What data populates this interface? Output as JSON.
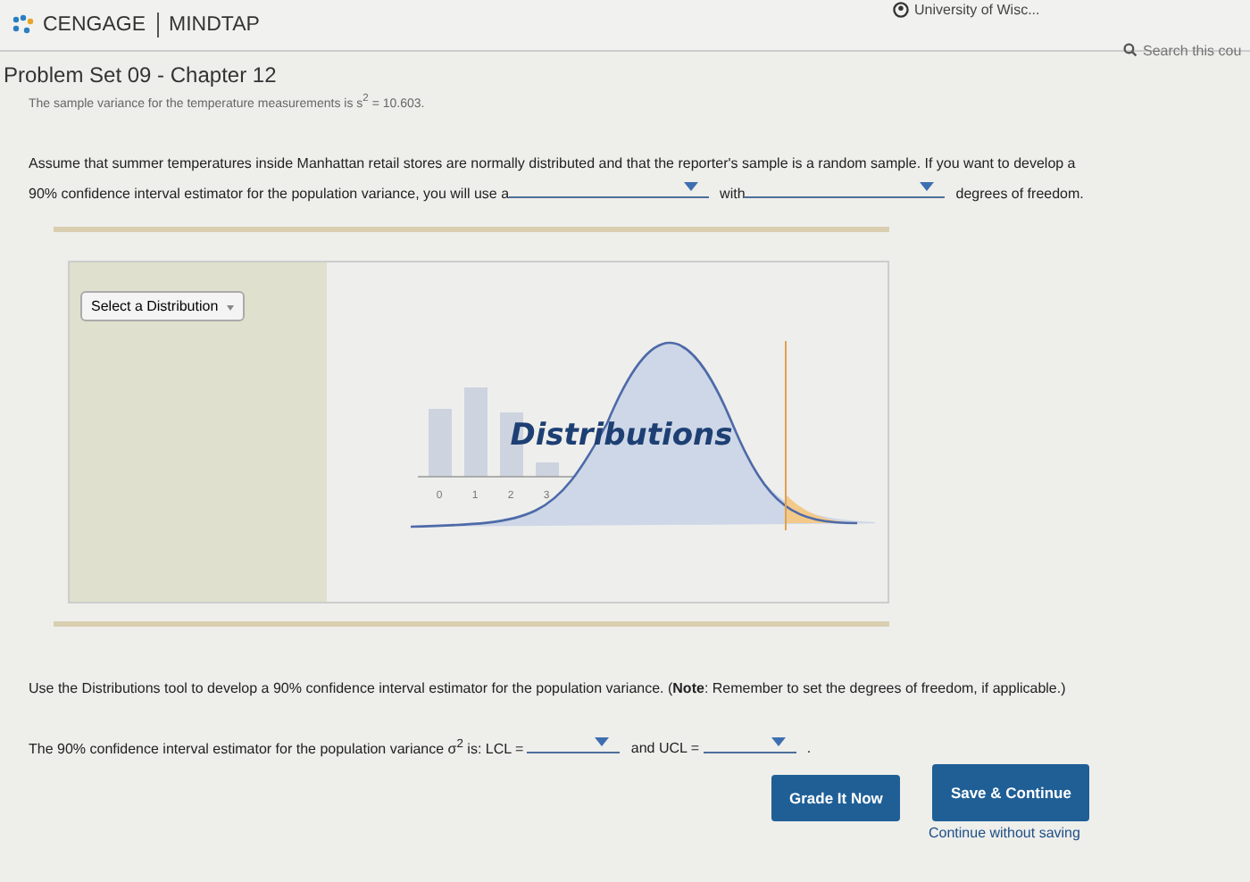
{
  "header": {
    "brand": "CENGAGE",
    "product": "MINDTAP",
    "account": "University of Wisc...",
    "search": {
      "placeholder": "Search this cou"
    }
  },
  "title": "Problem Set 09 - Chapter 12",
  "cut_line": "The sample variance for the temperature measurements is s$^{2}$ = 10.603.",
  "question": [
    {
      "kind": "text",
      "text": "Assume that summer temperatures inside Manhattan retail stores are normally distributed and that the reporter's sample is a random sample. If you want to develop a 90% confidence interval estimator for the population variance, you will use a"
    },
    {
      "kind": "dropdown"
    },
    {
      "kind": "text",
      "text": "with"
    },
    {
      "kind": "dropdown"
    },
    {
      "kind": "text",
      "text": "degrees of freedom."
    }
  ],
  "tool": {
    "select_label": "Select a Distribution",
    "logo_text": "Distributions",
    "axis_labels": [
      "0",
      "1",
      "2",
      "3"
    ]
  },
  "instruction": "Use the Distributions tool to develop a 90% confidence interval estimator for the population variance. (**Note**: Remember to set the degrees of freedom, if applicable.)",
  "answer": [
    {
      "kind": "text",
      "text": "The 90% confidence interval estimator for the population variance σ$^{2}$ is: LCL ="
    },
    {
      "kind": "dropdown"
    },
    {
      "kind": "text",
      "text": "and UCL ="
    },
    {
      "kind": "dropdown"
    },
    {
      "kind": "text",
      "text": "."
    }
  ],
  "buttons": [
    {
      "label": "Grade It Now"
    },
    {
      "label": "Save & Continue"
    }
  ],
  "link": "Continue without saving"
}
